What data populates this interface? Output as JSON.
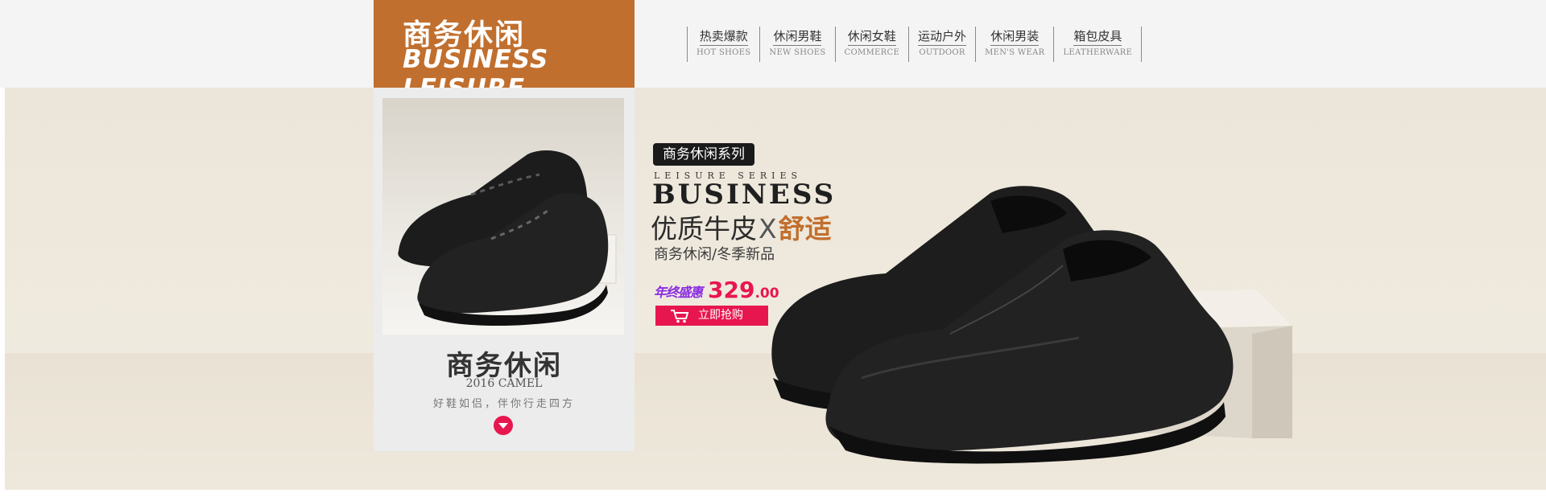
{
  "brand": {
    "title_cn": "商务休闲",
    "title_en": "BUSINESS LEISURE",
    "color": "#c16f2e"
  },
  "nav": [
    {
      "cn": "热卖爆款",
      "en": "HOT SHOES"
    },
    {
      "cn": "休闲男鞋",
      "en": "NEW SHOES"
    },
    {
      "cn": "休闲女鞋",
      "en": "COMMERCE"
    },
    {
      "cn": "运动户外",
      "en": "OUTDOOR"
    },
    {
      "cn": "休闲男装",
      "en": "MEN'S WEAR"
    },
    {
      "cn": "箱包皮具",
      "en": "LEATHERWARE"
    }
  ],
  "card": {
    "title": "商务休闲",
    "subtitle": "2016 CAMEL",
    "slogan": "好鞋如侣，伴你行走四方",
    "arrow_icon": "chevron-down-icon"
  },
  "promo": {
    "series_tag": "商务休闲系列",
    "series_en": "LEISURE SERIES",
    "headline_en": "BUSINESS",
    "headline_cn_1": "优质牛皮",
    "headline_cn_x": "X",
    "headline_cn_2": "舒适",
    "subline": "商务休闲/冬季新品",
    "event_label": "年终盛惠",
    "price_int": "329",
    "price_dec": ".00",
    "buy_label": "立即抢购",
    "cart_icon": "cart-icon",
    "accent_color": "#e8164f"
  }
}
